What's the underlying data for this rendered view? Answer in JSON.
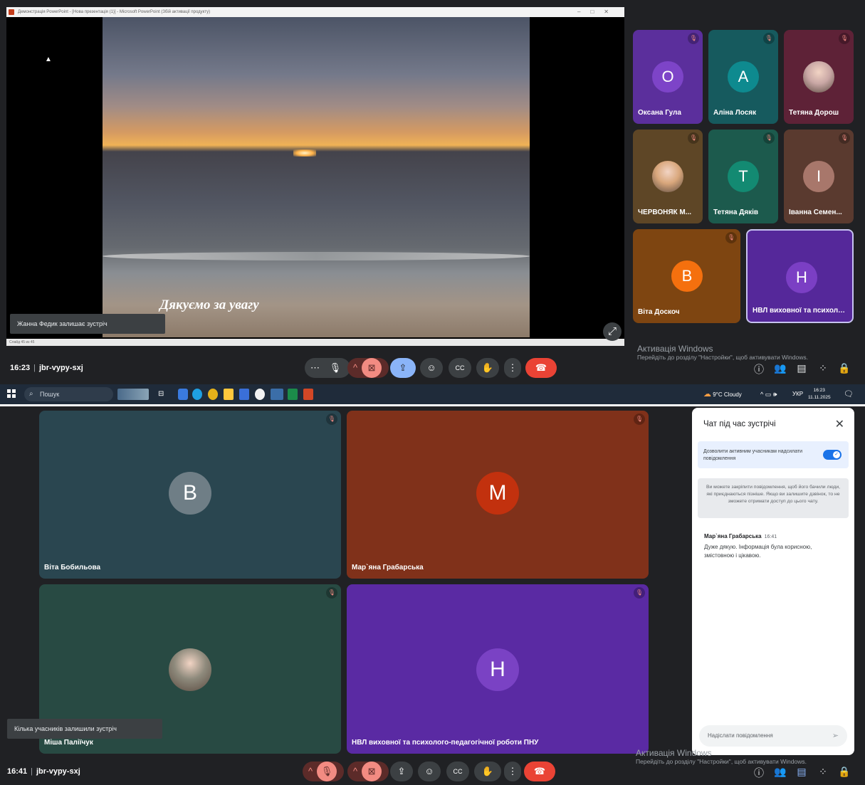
{
  "shot1": {
    "powerpoint": {
      "title_bar": "Демонстрація PowerPoint - [Нова презентація (1)] - Microsoft PowerPoint (Збій активації продукту)",
      "status": "Слайд 45 из 45",
      "caption": "Дякуємо за увагу"
    },
    "toast": "Жанна Федик залишає зустріч",
    "participants": [
      {
        "name": "Оксана Гула",
        "initial": "О",
        "avatar_color": "#7d44c8",
        "tile_color": "#5b2f9c",
        "muted": true
      },
      {
        "name": "Аліна Лосяк",
        "initial": "А",
        "avatar_color": "#0e8a8f",
        "tile_color": "#165a5e",
        "muted": true
      },
      {
        "name": "Тетяна Дорош",
        "initial": "",
        "avatar_color": "#c9a7a5",
        "tile_color": "#5e2237",
        "muted": true
      },
      {
        "name": "ЧЕРВОНЯК М...",
        "initial": "",
        "avatar_color": "#d9a77c",
        "tile_color": "#5e4626",
        "muted": true
      },
      {
        "name": "Тетяна Дяків",
        "initial": "Т",
        "avatar_color": "#138a72",
        "tile_color": "#1c5a4d",
        "muted": true
      },
      {
        "name": "Іванна Семен...",
        "initial": "І",
        "avatar_color": "#a8776b",
        "tile_color": "#5a3a2f",
        "muted": true
      },
      {
        "name": "Віта Доскоч",
        "initial": "В",
        "avatar_color": "#f5700e",
        "tile_color": "#7e4511",
        "muted": true
      },
      {
        "name": "НВЛ виховної та психоло...",
        "initial": "Н",
        "avatar_color": "#7b3fc4",
        "tile_color": "#55289a",
        "muted": false
      }
    ],
    "windows_activation": {
      "line1": "Активація Windows",
      "line2": "Перейдіть до розділу \"Настройки\", щоб активувати Windows."
    },
    "controls": {
      "time": "16:23",
      "code": "jbr-vypy-sxj"
    },
    "taskbar": {
      "search": "Пошук",
      "weather": "9°C  Cloudy",
      "lang": "УКР",
      "clock_time": "16:23",
      "clock_date": "11.11.2025"
    }
  },
  "shot2": {
    "participants": [
      {
        "name": "Віта Бобильова",
        "initial": "В",
        "avatar_color": "#6f7e86",
        "tile_color": "#2a4650",
        "muted": true
      },
      {
        "name": "Мар`яна Грабарська",
        "initial": "М",
        "avatar_color": "#c2310e",
        "tile_color": "#80311a",
        "muted": true
      },
      {
        "name": "Міша Паліїчук",
        "initial": "",
        "avatar_color": "#8e8a7c",
        "tile_color": "#284a43",
        "muted": true
      },
      {
        "name": "НВЛ виховної та психолого-педагогічної роботи ПНУ",
        "initial": "Н",
        "avatar_color": "#7a42c4",
        "tile_color": "#5a2aa3",
        "muted": true
      }
    ],
    "toast": "Кілька учасників залишили зустріч",
    "chat": {
      "title": "Чат під час зустрічі",
      "toggle_label": "Дозволити активним учасникам надсилати повідомлення",
      "pin_info": "Ви можете закріпити повідомлення, щоб його бачили люди, які приєднаються пізніше. Якщо ви залишите дзвінок, то не зможете отримати доступ до цього чату.",
      "message": {
        "author": "Мар`яна Грабарська",
        "time": "16:41",
        "text": "Дуже дякую. Інформація була корисною, змістовною і цікавою."
      },
      "input_placeholder": "Надіслати повідомлення"
    },
    "windows_activation": {
      "line1": "Активація Windows",
      "line2": "Перейдіть до розділу \"Настройки\", щоб активувати Windows."
    },
    "controls": {
      "time": "16:41",
      "code": "jbr-vypy-sxj"
    }
  }
}
